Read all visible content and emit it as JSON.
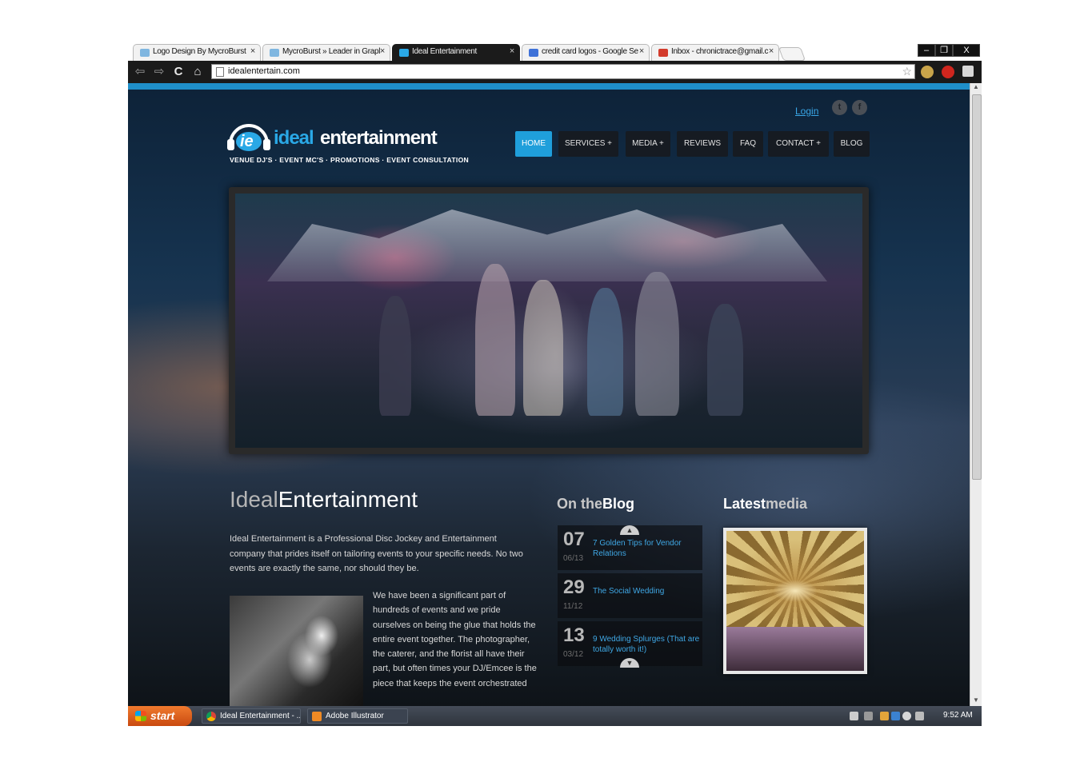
{
  "browser": {
    "tabs": [
      {
        "label": "Logo Design By MycroBurst",
        "active": false
      },
      {
        "label": "MycroBurst » Leader in Grapl",
        "active": false
      },
      {
        "label": "Ideal Entertainment",
        "active": true
      },
      {
        "label": "credit card logos - Google Se",
        "active": false
      },
      {
        "label": "Inbox - chronictrace@gmail.c",
        "active": false
      }
    ],
    "tab_close": "×",
    "window_buttons": {
      "minimize": "–",
      "restore": "❐",
      "close": "X"
    },
    "nav": {
      "back": "⇦",
      "forward": "⇨",
      "reload": "C",
      "home": "⌂"
    },
    "url": "idealentertain.com",
    "star": "☆"
  },
  "site": {
    "login": "Login",
    "social": [
      {
        "name": "twitter-icon",
        "glyph": "t"
      },
      {
        "name": "facebook-icon",
        "glyph": "f"
      }
    ],
    "logo": {
      "mark": "ie",
      "word1": "ideal",
      "word2": "entertainment",
      "tagline": "VENUE DJ'S · EVENT MC'S · PROMOTIONS · EVENT CONSULTATION"
    },
    "nav": [
      {
        "label": "HOME",
        "active": true
      },
      {
        "label": "SERVICES +",
        "active": false
      },
      {
        "label": "MEDIA +",
        "active": false
      },
      {
        "label": "REVIEWS",
        "active": false
      },
      {
        "label": "FAQ",
        "active": false
      },
      {
        "label": "CONTACT +",
        "active": false
      },
      {
        "label": "BLOG",
        "active": false
      }
    ],
    "about": {
      "title_a": "Ideal",
      "title_b": "Entertainment",
      "intro": "Ideal Entertainment is a Professional Disc Jockey and Entertainment company that prides itself on tailoring events to your specific needs. No two events are exactly the same, nor should they be.",
      "body": "We have been a significant part of hundreds of events and we pride ourselves on being the glue that holds the entire event together. The photographer, the caterer, and the florist all have their part, but often times your DJ/Emcee is the piece that keeps the event orchestrated"
    },
    "blog": {
      "title_a": "On the",
      "title_b": "Blog",
      "posts": [
        {
          "day": "07",
          "date": "06/13",
          "title": "7 Golden Tips for Vendor Relations"
        },
        {
          "day": "29",
          "date": "11/12",
          "title": "The Social Wedding"
        },
        {
          "day": "13",
          "date": "03/12",
          "title": "9 Wedding Splurges (That are totally worth it!)"
        }
      ],
      "up": "▲",
      "down": "▼"
    },
    "media": {
      "title_a": "Latest",
      "title_b": "media"
    }
  },
  "taskbar": {
    "start": "start",
    "items": [
      {
        "label": "Ideal Entertainment - ..."
      },
      {
        "label": "Adobe Illustrator"
      }
    ],
    "clock": "9:52 AM"
  },
  "colors": {
    "accent": "#1f9fdb",
    "link": "#3fa7e4",
    "topbar": "#1f8fc9",
    "start": "#e0621f"
  }
}
